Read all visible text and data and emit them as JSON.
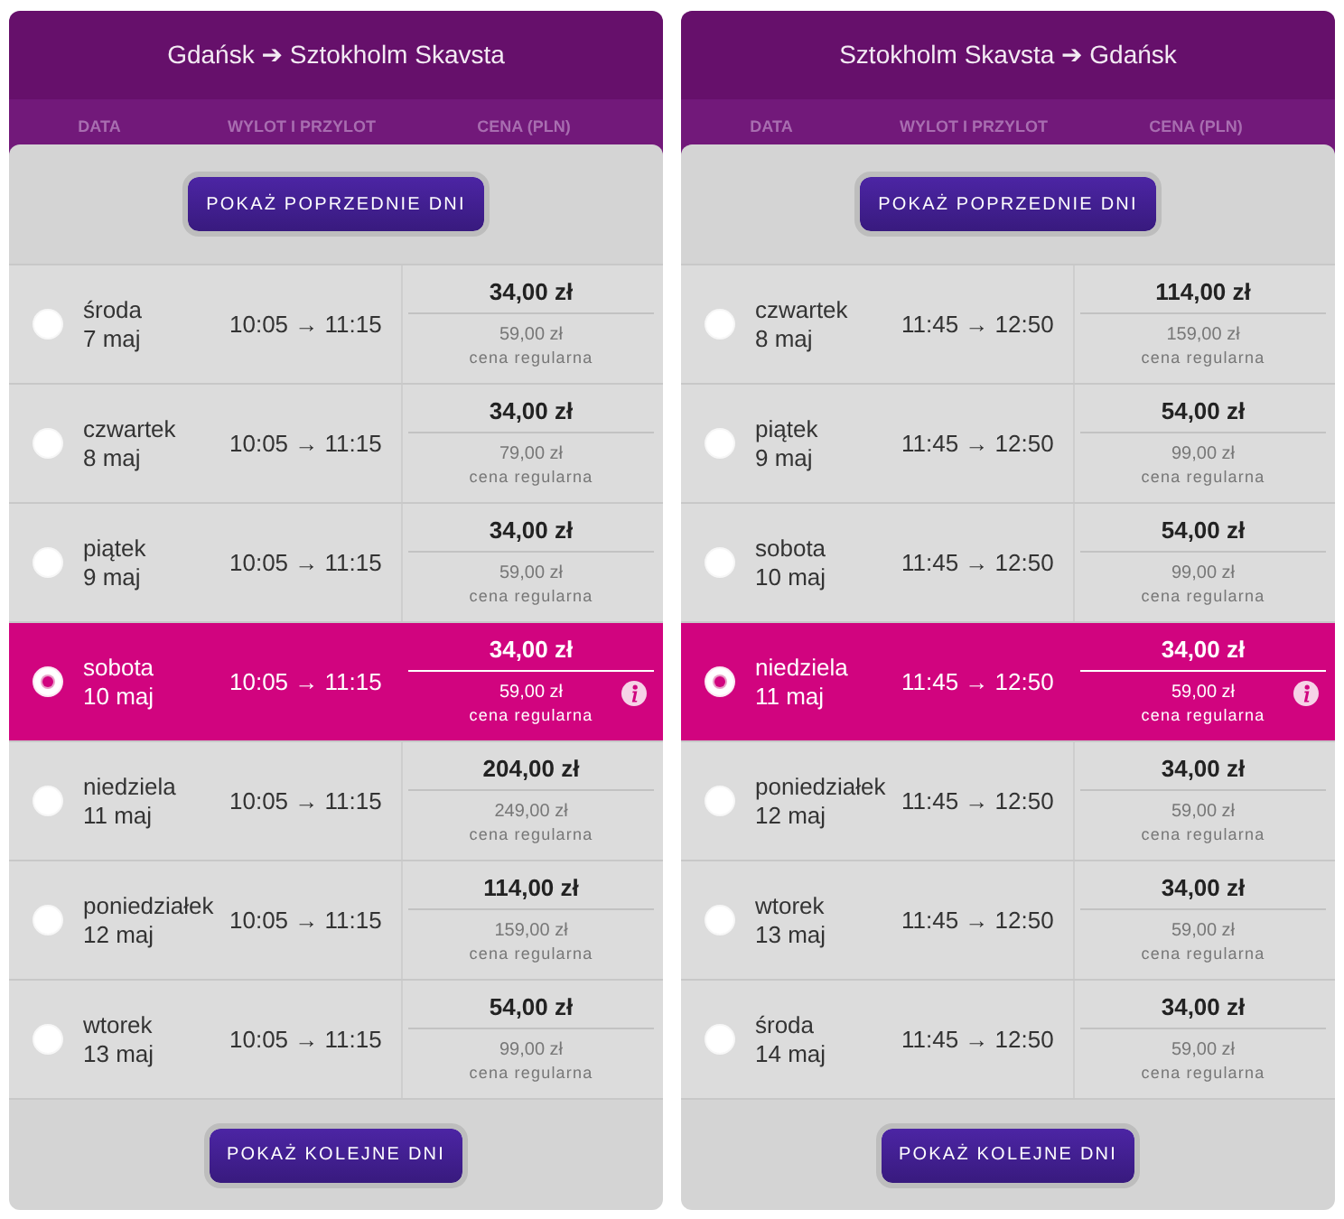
{
  "panels": [
    {
      "title": "Gdańsk ➔ Sztokholm Skavsta",
      "columns": [
        "DATA",
        "WYLOT I PRZYLOT",
        "CENA (PLN)"
      ],
      "previous_button": "POKAŻ POPRZEDNIE DNI",
      "flights": [
        {
          "day": "środa",
          "date": "7 maj",
          "times": "10:05 → 11:15",
          "price": "34,00 zł",
          "regular_price": "59,00 zł",
          "regular_label": "cena regularna",
          "selected": false
        },
        {
          "day": "czwartek",
          "date": "8 maj",
          "times": "10:05 → 11:15",
          "price": "34,00 zł",
          "regular_price": "79,00 zł",
          "regular_label": "cena regularna",
          "selected": false
        },
        {
          "day": "piątek",
          "date": "9 maj",
          "times": "10:05 → 11:15",
          "price": "34,00 zł",
          "regular_price": "59,00 zł",
          "regular_label": "cena regularna",
          "selected": false
        },
        {
          "day": "sobota",
          "date": "10 maj",
          "times": "10:05 → 11:15",
          "price": "34,00 zł",
          "regular_price": "59,00 zł",
          "regular_label": "cena regularna",
          "selected": true
        },
        {
          "day": "niedziela",
          "date": "11 maj",
          "times": "10:05 → 11:15",
          "price": "204,00 zł",
          "regular_price": "249,00 zł",
          "regular_label": "cena regularna",
          "selected": false
        },
        {
          "day": "poniedziałek",
          "date": "12 maj",
          "times": "10:05 → 11:15",
          "price": "114,00 zł",
          "regular_price": "159,00 zł",
          "regular_label": "cena regularna",
          "selected": false
        },
        {
          "day": "wtorek",
          "date": "13 maj",
          "times": "10:05 → 11:15",
          "price": "54,00 zł",
          "regular_price": "99,00 zł",
          "regular_label": "cena regularna",
          "selected": false
        }
      ],
      "next_button": "POKAŻ KOLEJNE DNI"
    },
    {
      "title": "Sztokholm Skavsta ➔ Gdańsk",
      "columns": [
        "DATA",
        "WYLOT I PRZYLOT",
        "CENA (PLN)"
      ],
      "previous_button": "POKAŻ POPRZEDNIE DNI",
      "flights": [
        {
          "day": "czwartek",
          "date": "8 maj",
          "times": "11:45 → 12:50",
          "price": "114,00 zł",
          "regular_price": "159,00 zł",
          "regular_label": "cena regularna",
          "selected": false
        },
        {
          "day": "piątek",
          "date": "9 maj",
          "times": "11:45 → 12:50",
          "price": "54,00 zł",
          "regular_price": "99,00 zł",
          "regular_label": "cena regularna",
          "selected": false
        },
        {
          "day": "sobota",
          "date": "10 maj",
          "times": "11:45 → 12:50",
          "price": "54,00 zł",
          "regular_price": "99,00 zł",
          "regular_label": "cena regularna",
          "selected": false
        },
        {
          "day": "niedziela",
          "date": "11 maj",
          "times": "11:45 → 12:50",
          "price": "34,00 zł",
          "regular_price": "59,00 zł",
          "regular_label": "cena regularna",
          "selected": true
        },
        {
          "day": "poniedziałek",
          "date": "12 maj",
          "times": "11:45 → 12:50",
          "price": "34,00 zł",
          "regular_price": "59,00 zł",
          "regular_label": "cena regularna",
          "selected": false
        },
        {
          "day": "wtorek",
          "date": "13 maj",
          "times": "11:45 → 12:50",
          "price": "34,00 zł",
          "regular_price": "59,00 zł",
          "regular_label": "cena regularna",
          "selected": false
        },
        {
          "day": "środa",
          "date": "14 maj",
          "times": "11:45 → 12:50",
          "price": "34,00 zł",
          "regular_price": "59,00 zł",
          "regular_label": "cena regularna",
          "selected": false
        }
      ],
      "next_button": "POKAŻ KOLEJNE DNI"
    }
  ]
}
